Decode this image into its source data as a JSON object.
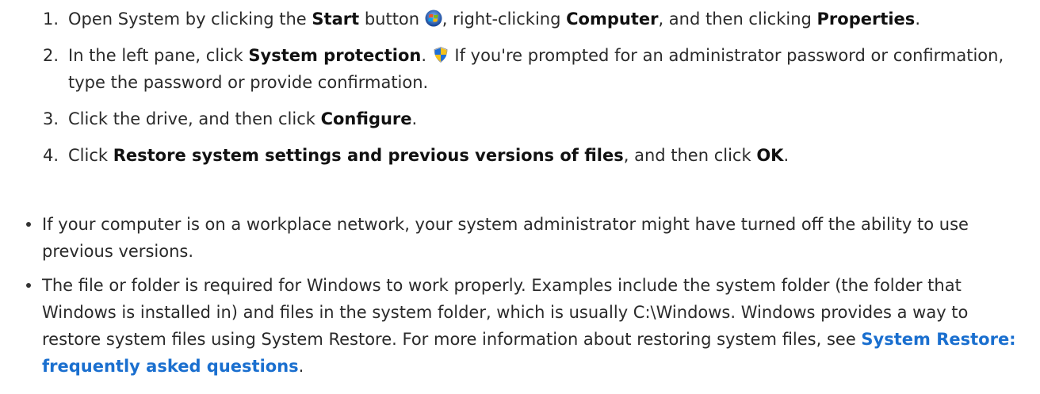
{
  "steps": [
    {
      "num": "1.",
      "t1": "Open System by clicking the ",
      "b1": "Start",
      "t2": " button ",
      "t3": ", right-clicking ",
      "b2": "Computer",
      "t4": ", and then clicking ",
      "b3": "Properties",
      "t5": "."
    },
    {
      "num": "2.",
      "t1": "In the left pane, click ",
      "b1": "System protection",
      "t2": ". ",
      "t3": " If you're prompted for an administrator password or confirmation, type the password or provide confirmation."
    },
    {
      "num": "3.",
      "t1": "Click the drive, and then click ",
      "b1": "Configure",
      "t2": "."
    },
    {
      "num": "4.",
      "t1": "Click ",
      "b1": "Restore system settings and previous versions of files",
      "t2": ", and then click ",
      "b2": "OK",
      "t3": "."
    }
  ],
  "notes": [
    {
      "text": "If your computer is on a workplace network, your system administrator might have turned off the ability to use previous versions."
    },
    {
      "text": "The file or folder is required for Windows to work properly. Examples include the system folder (the folder that Windows is installed in) and files in the system folder, which is usually C:\\Windows. Windows provides a way to restore system files using System Restore. For more information about restoring system files, see ",
      "link": "System Restore: frequently asked questions",
      "end": "."
    }
  ],
  "icons": {
    "start": "windows-start-orb-icon",
    "shield": "uac-shield-icon"
  }
}
